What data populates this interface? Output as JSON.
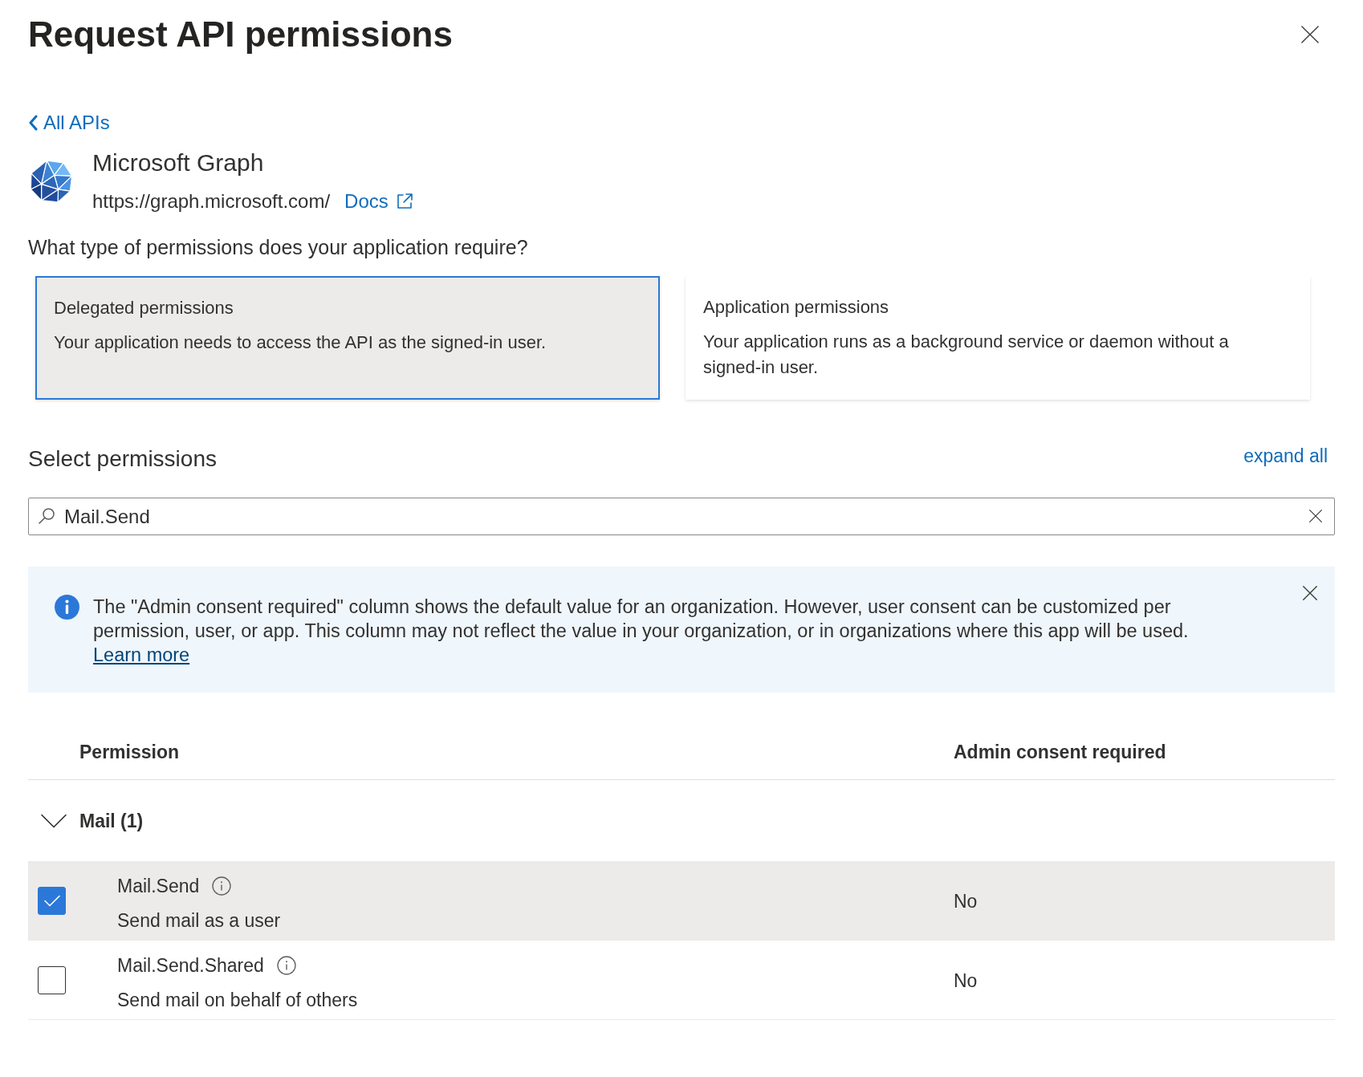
{
  "dialog": {
    "title": "Request API permissions",
    "back_link": "All APIs"
  },
  "api": {
    "name": "Microsoft Graph",
    "url": "https://graph.microsoft.com/",
    "docs_link": "Docs"
  },
  "question": "What type of permissions does your application require?",
  "permission_types": [
    {
      "title": "Delegated permissions",
      "description": "Your application needs to access the API as the signed-in user.",
      "selected": true
    },
    {
      "title": "Application permissions",
      "description": "Your application runs as a background service or daemon without a signed-in user.",
      "selected": false
    }
  ],
  "select_permissions": {
    "heading": "Select permissions",
    "expand_all": "expand all"
  },
  "search": {
    "value": "Mail.Send"
  },
  "info_bar": {
    "text": "The \"Admin consent required\" column shows the default value for an organization. However, user consent can be customized per permission, user, or app. This column may not reflect the value in your organization, or in organizations where this app will be used.",
    "link": "Learn more"
  },
  "table": {
    "columns": [
      "Permission",
      "Admin consent required"
    ],
    "groups": [
      {
        "label": "Mail (1)",
        "expanded": true,
        "items": [
          {
            "name": "Mail.Send",
            "description": "Send mail as a user",
            "admin_consent": "No",
            "checked": true
          },
          {
            "name": "Mail.Send.Shared",
            "description": "Send mail on behalf of others",
            "admin_consent": "No",
            "checked": false
          }
        ]
      }
    ]
  }
}
